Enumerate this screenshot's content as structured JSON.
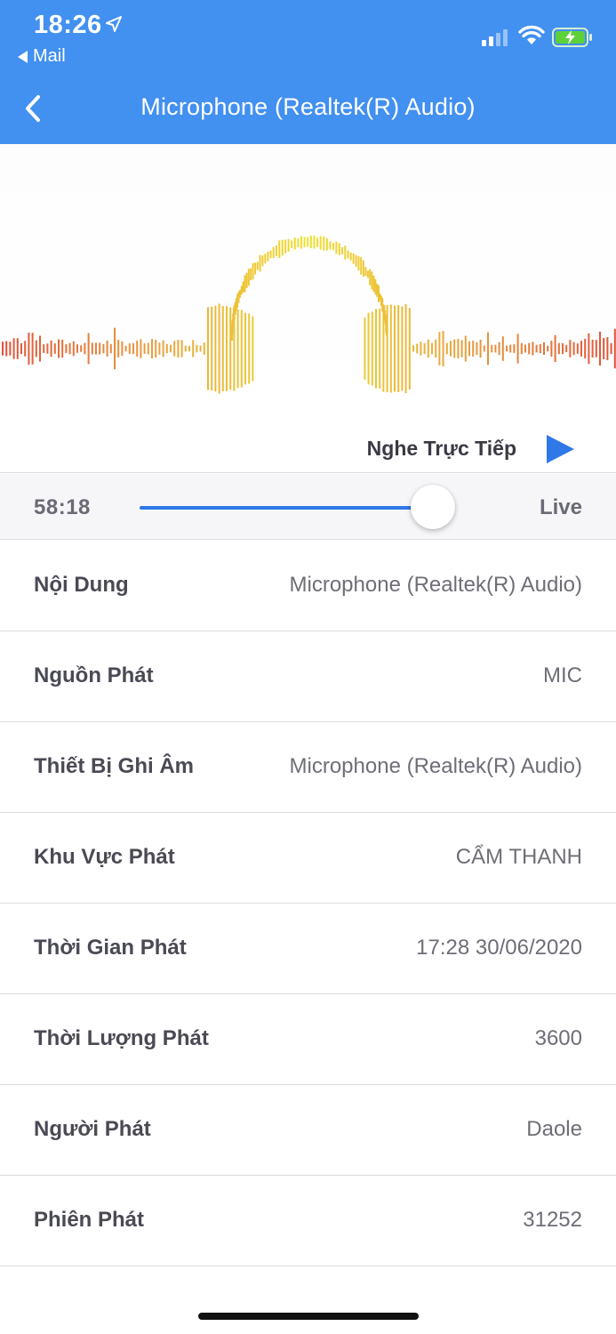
{
  "status_bar": {
    "time": "18:26",
    "back_app": "Mail"
  },
  "nav": {
    "title": "Microphone (Realtek(R) Audio)"
  },
  "player": {
    "live_listen_label": "Nghe Trực Tiếp",
    "elapsed": "58:18",
    "end_label": "Live",
    "progress": 0.93
  },
  "colors": {
    "header_blue": "#4290f0",
    "accent_blue": "#2f78e8",
    "wave_red": "#e0503a",
    "wave_orange": "#e8a040",
    "wave_yellow": "#f0e030"
  },
  "info": [
    {
      "label": "Nội Dung",
      "value": "Microphone (Realtek(R) Audio)"
    },
    {
      "label": "Nguồn Phát",
      "value": "MIC"
    },
    {
      "label": "Thiết Bị Ghi Âm",
      "value": "Microphone (Realtek(R) Audio)"
    },
    {
      "label": "Khu Vực Phát",
      "value": "CẨM THANH"
    },
    {
      "label": "Thời Gian Phát",
      "value": "17:28 30/06/2020"
    },
    {
      "label": "Thời Lượng Phát",
      "value": "3600"
    },
    {
      "label": "Người Phát",
      "value": "Daole"
    },
    {
      "label": "Phiên Phát",
      "value": "31252"
    }
  ],
  "icons": {
    "location": "location-arrow-icon",
    "signal": "cellular-signal-icon",
    "wifi": "wifi-icon",
    "battery": "battery-charging-icon",
    "back": "chevron-left-icon",
    "play": "play-icon",
    "artwork": "headphones-waveform-icon"
  }
}
